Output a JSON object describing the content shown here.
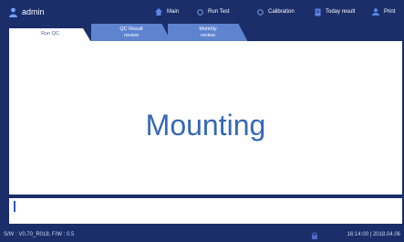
{
  "topbar": {
    "user": "admin",
    "nav": [
      {
        "label": "Main",
        "icon": "home-icon"
      },
      {
        "label": "Run Test",
        "icon": "run-test-icon"
      },
      {
        "label": "Calibration",
        "icon": "calibration-icon"
      },
      {
        "label": "Today result",
        "icon": "today-result-icon"
      },
      {
        "label": "Print",
        "icon": "print-icon"
      }
    ]
  },
  "tabs": [
    {
      "label": "Run QC"
    },
    {
      "label_line1": "QC Result",
      "label_line2": "review"
    },
    {
      "label_line1": "Monthly",
      "label_line2": "review"
    }
  ],
  "main": {
    "status_text": "Mounting"
  },
  "status": {
    "version": "S/W : V0.70_R018, F/W : 0.5",
    "datetime": "16:14:00 | 2018.04.06"
  },
  "colors": {
    "header_bg": "#1b2e6a",
    "tab_bg": "#5e84cf",
    "accent_text": "#3567b5"
  }
}
